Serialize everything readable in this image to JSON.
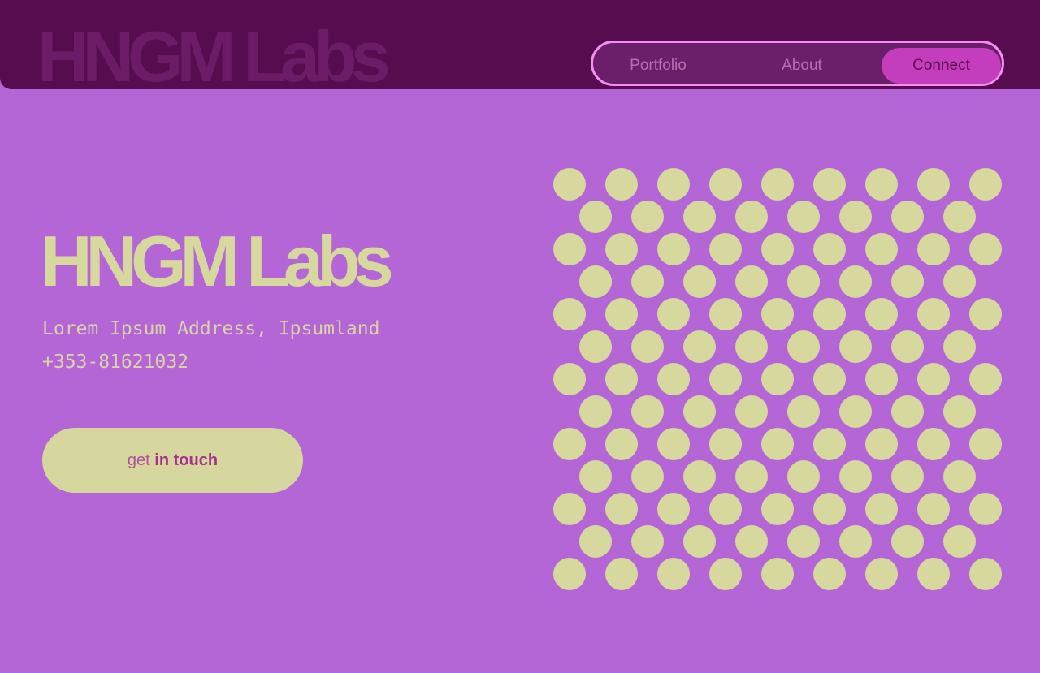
{
  "header": {
    "logo_text": "HNGM Labs"
  },
  "nav": {
    "items": [
      {
        "label": "Portfolio"
      },
      {
        "label": "About"
      },
      {
        "label": "Connect"
      }
    ],
    "active": "Connect"
  },
  "hero": {
    "logo_text": "HNGM Labs",
    "address": "Lorem Ipsum Address, Ipsumland",
    "phone": "+353-81621032",
    "cta": {
      "prefix": "get",
      "strong": "in touch"
    }
  },
  "pattern": {
    "icon": "dot-grid-pattern",
    "dot_color": "#d6d89e"
  },
  "colors": {
    "background": "#b466d6",
    "header": "#560c4f",
    "accent": "#c33dbd",
    "nav_border": "#f48ef2"
  }
}
